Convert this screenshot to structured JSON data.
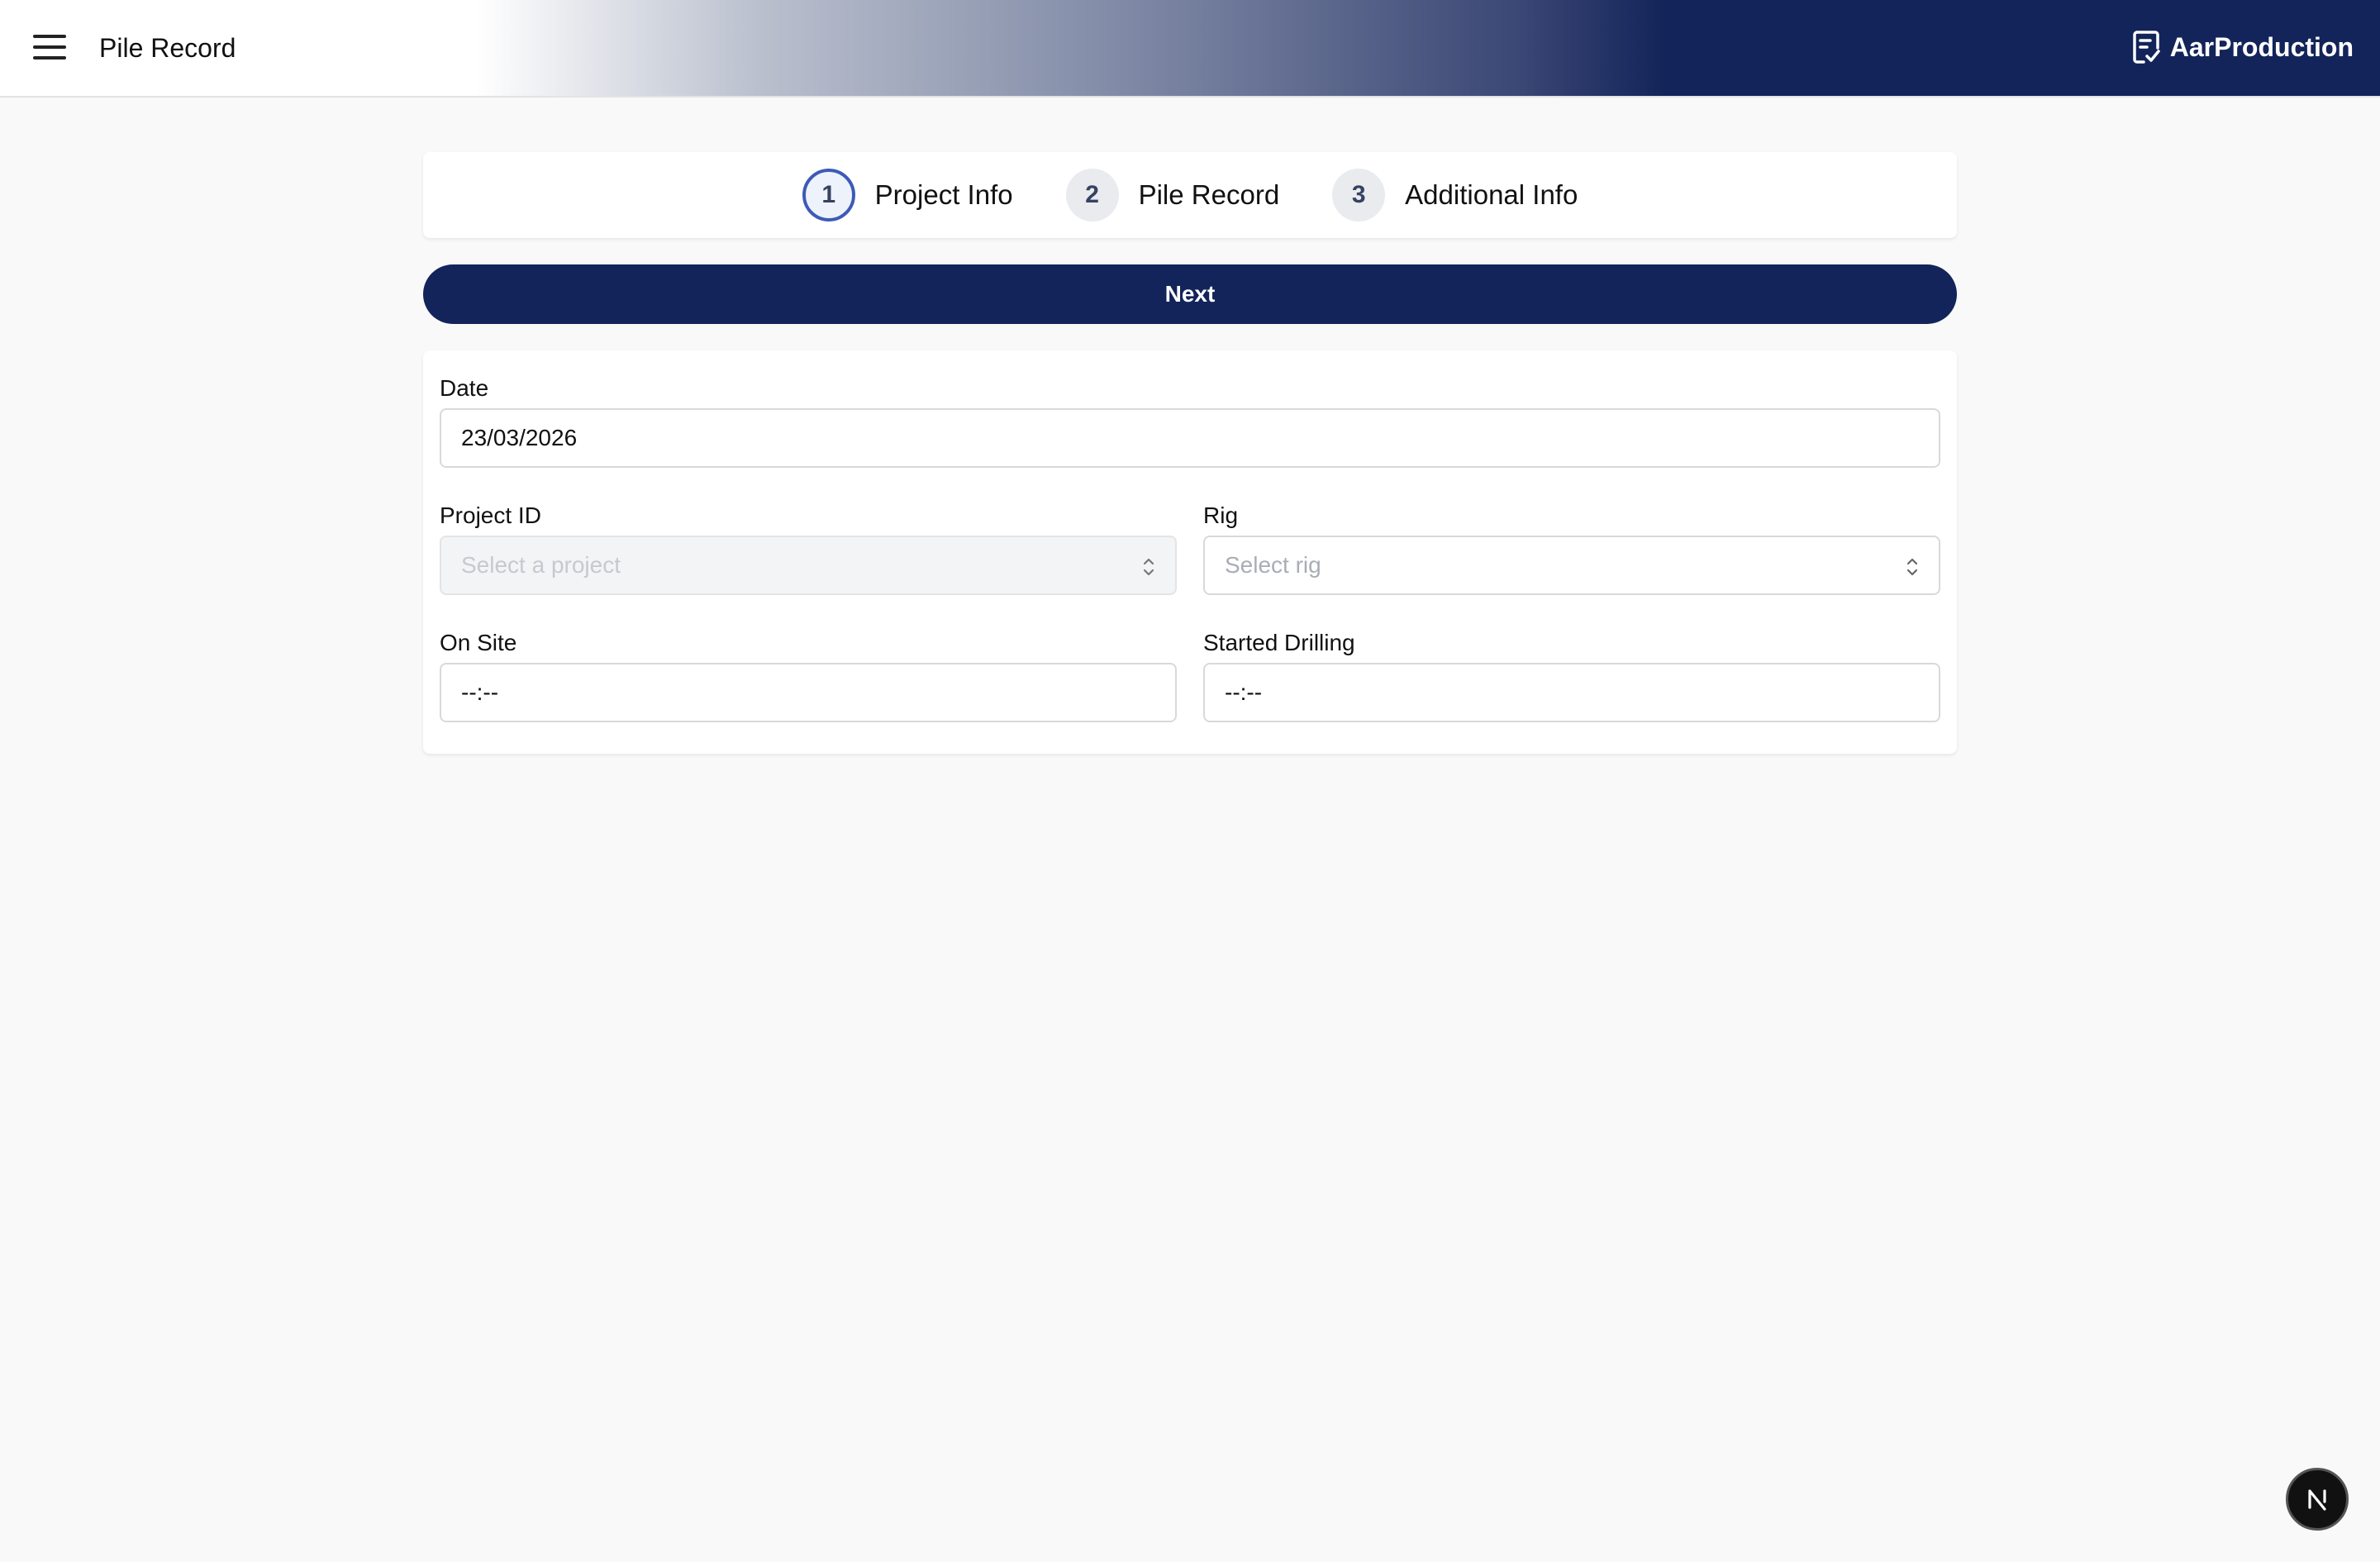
{
  "header": {
    "title": "Pile Record",
    "brand_name": "AarProduction",
    "brand_icon": "clipboard-check-icon",
    "menu_icon": "hamburger-menu-icon"
  },
  "stepper": {
    "steps": [
      {
        "number": "1",
        "label": "Project Info",
        "active": true
      },
      {
        "number": "2",
        "label": "Pile Record",
        "active": false
      },
      {
        "number": "3",
        "label": "Additional Info",
        "active": false
      }
    ]
  },
  "actions": {
    "next_label": "Next"
  },
  "form": {
    "date": {
      "label": "Date",
      "value": "23/03/2026"
    },
    "project_id": {
      "label": "Project ID",
      "placeholder": "Select a project",
      "disabled": true
    },
    "rig": {
      "label": "Rig",
      "placeholder": "Select rig"
    },
    "on_site": {
      "label": "On Site",
      "value": "--:--"
    },
    "started_drilling": {
      "label": "Started Drilling",
      "value": "--:--"
    }
  },
  "colors": {
    "brand": "#13245a",
    "active_step_ring": "#3e5ab8",
    "background": "#f9f9f9"
  }
}
